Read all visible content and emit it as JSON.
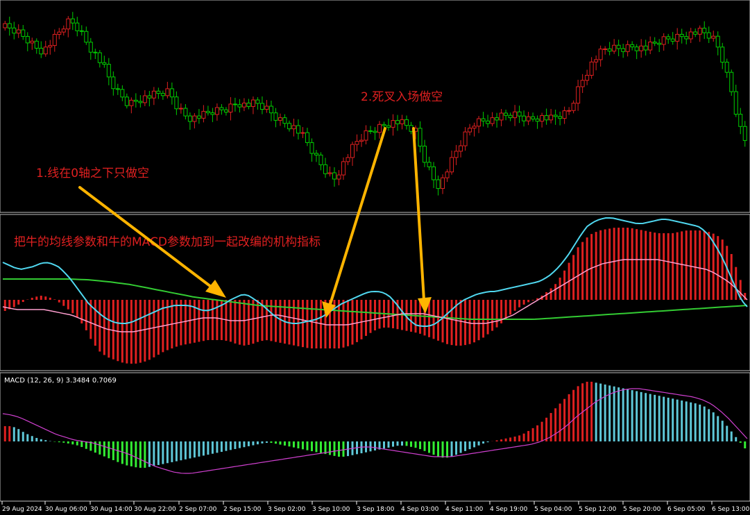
{
  "chart_data": {
    "type": "candlestick",
    "annotations": {
      "note1": "1.线在0轴之下只做空",
      "note2": "2.死叉入场做空",
      "subtitle": "把牛的均线参数和牛的MACD参数加到一起改编的机构指标"
    },
    "macd_label": "MACD (12, 26, 9)  3.3484  0.7069",
    "x_labels": [
      "29 Aug 2024",
      "30 Aug 06:00",
      "30 Aug 14:00",
      "30 Aug 22:00",
      "2 Sep 07:00",
      "2 Sep 15:00",
      "3 Sep 02:00",
      "3 Sep 10:00",
      "3 Sep 18:00",
      "4 Sep 03:00",
      "4 Sep 11:00",
      "4 Sep 19:00",
      "5 Sep 04:00",
      "5 Sep 12:00",
      "5 Sep 20:00",
      "6 Sep 05:00",
      "6 Sep 13:00"
    ],
    "price_path": [
      40,
      42,
      46,
      52,
      58,
      66,
      72,
      70,
      60,
      50,
      38,
      30,
      36,
      48,
      62,
      74,
      86,
      100,
      118,
      132,
      140,
      150,
      146,
      142,
      140,
      138,
      136,
      134,
      132,
      150,
      160,
      168,
      170,
      168,
      166,
      162,
      160,
      158,
      156,
      150,
      148,
      152,
      150,
      150,
      155,
      160,
      168,
      174,
      178,
      182,
      190,
      200,
      214,
      228,
      240,
      250,
      258,
      244,
      230,
      216,
      204,
      196,
      190,
      186,
      182,
      178,
      176,
      176,
      180,
      185,
      190,
      220,
      240,
      258,
      268,
      250,
      234,
      216,
      200,
      186,
      176,
      174,
      172,
      172,
      170,
      168,
      166,
      166,
      168,
      172,
      170,
      168,
      170,
      172,
      168,
      166,
      160,
      140,
      120,
      104,
      90,
      80,
      72,
      70,
      70,
      70,
      68,
      66,
      68,
      70,
      66,
      62,
      58,
      56,
      54,
      52,
      50,
      48,
      46,
      48,
      52,
      60,
      80,
      110,
      140,
      180,
      200
    ],
    "hist_path": [
      -16,
      -12,
      -6,
      0,
      4,
      6,
      4,
      0,
      -8,
      -16,
      -26,
      -40,
      -60,
      -74,
      -82,
      -86,
      -90,
      -92,
      -92,
      -90,
      -86,
      -80,
      -74,
      -70,
      -66,
      -64,
      -62,
      -60,
      -58,
      -58,
      -58,
      -60,
      -64,
      -66,
      -64,
      -60,
      -58,
      -60,
      -62,
      -64,
      -66,
      -68,
      -70,
      -70,
      -70,
      -70,
      -70,
      -68,
      -64,
      -58,
      -50,
      -44,
      -40,
      -40,
      -42,
      -44,
      -46,
      -48,
      -52,
      -56,
      -60,
      -64,
      -66,
      -66,
      -64,
      -60,
      -54,
      -46,
      -38,
      -28,
      -18,
      -10,
      -4,
      0,
      6,
      14,
      24,
      40,
      58,
      76,
      88,
      96,
      100,
      102,
      104,
      104,
      104,
      102,
      100,
      98,
      96,
      96,
      96,
      98,
      100,
      100,
      100,
      98,
      94,
      86,
      70,
      40,
      10
    ],
    "fast_path": [
      54,
      50,
      46,
      44,
      46,
      48,
      52,
      54,
      52,
      48,
      40,
      30,
      18,
      6,
      -6,
      -14,
      -22,
      -28,
      -32,
      -34,
      -34,
      -32,
      -28,
      -24,
      -20,
      -16,
      -12,
      -10,
      -8,
      -8,
      -8,
      -10,
      -14,
      -16,
      -14,
      -10,
      -6,
      0,
      4,
      8,
      6,
      0,
      -6,
      -14,
      -22,
      -28,
      -32,
      -34,
      -34,
      -32,
      -30,
      -28,
      -24,
      -18,
      -12,
      -6,
      -2,
      2,
      6,
      10,
      12,
      12,
      10,
      4,
      -6,
      -18,
      -28,
      -36,
      -38,
      -38,
      -36,
      -30,
      -22,
      -14,
      -6,
      0,
      4,
      8,
      10,
      12,
      12,
      14,
      16,
      18,
      20,
      22,
      24,
      26,
      30,
      36,
      44,
      54,
      66,
      80,
      94,
      106,
      112,
      116,
      118,
      118,
      116,
      114,
      112,
      110,
      110,
      112,
      114,
      116,
      116,
      114,
      112,
      110,
      108,
      106,
      100,
      90,
      76,
      60,
      40,
      20,
      0,
      -10
    ],
    "signal_path": [
      -10,
      -12,
      -14,
      -14,
      -14,
      -14,
      -14,
      -16,
      -18,
      -20,
      -22,
      -26,
      -30,
      -34,
      -38,
      -42,
      -44,
      -46,
      -46,
      -46,
      -44,
      -42,
      -40,
      -38,
      -36,
      -34,
      -32,
      -30,
      -28,
      -26,
      -26,
      -26,
      -28,
      -30,
      -30,
      -30,
      -28,
      -26,
      -24,
      -22,
      -22,
      -24,
      -26,
      -28,
      -30,
      -32,
      -34,
      -36,
      -36,
      -36,
      -36,
      -34,
      -32,
      -30,
      -28,
      -26,
      -24,
      -22,
      -20,
      -20,
      -20,
      -20,
      -22,
      -24,
      -26,
      -28,
      -30,
      -32,
      -34,
      -34,
      -34,
      -32,
      -30,
      -26,
      -22,
      -16,
      -10,
      -4,
      2,
      8,
      14,
      20,
      26,
      32,
      38,
      44,
      48,
      52,
      54,
      56,
      58,
      58,
      58,
      58,
      58,
      58,
      56,
      54,
      52,
      50,
      48,
      46,
      44,
      40,
      34,
      28,
      20,
      10,
      0
    ],
    "macd_hist_path": [
      22,
      22,
      18,
      12,
      8,
      4,
      2,
      0,
      -1,
      -2,
      -4,
      -6,
      -10,
      -14,
      -18,
      -22,
      -26,
      -30,
      -34,
      -36,
      -38,
      -38,
      -36,
      -34,
      -32,
      -30,
      -28,
      -26,
      -24,
      -22,
      -20,
      -18,
      -16,
      -14,
      -12,
      -10,
      -8,
      -6,
      -4,
      -2,
      -2,
      -4,
      -6,
      -8,
      -10,
      -12,
      -14,
      -16,
      -18,
      -20,
      -22,
      -22,
      -20,
      -18,
      -16,
      -14,
      -12,
      -10,
      -8,
      -6,
      -6,
      -8,
      -10,
      -14,
      -18,
      -22,
      -24,
      -22,
      -18,
      -14,
      -10,
      -6,
      -2,
      0,
      2,
      4,
      6,
      8,
      12,
      18,
      24,
      32,
      42,
      52,
      62,
      72,
      80,
      86,
      86,
      84,
      82,
      80,
      78,
      76,
      74,
      72,
      70,
      68,
      66,
      64,
      62,
      60,
      58,
      56,
      54,
      50,
      44,
      36,
      26,
      14,
      2,
      -10
    ]
  }
}
